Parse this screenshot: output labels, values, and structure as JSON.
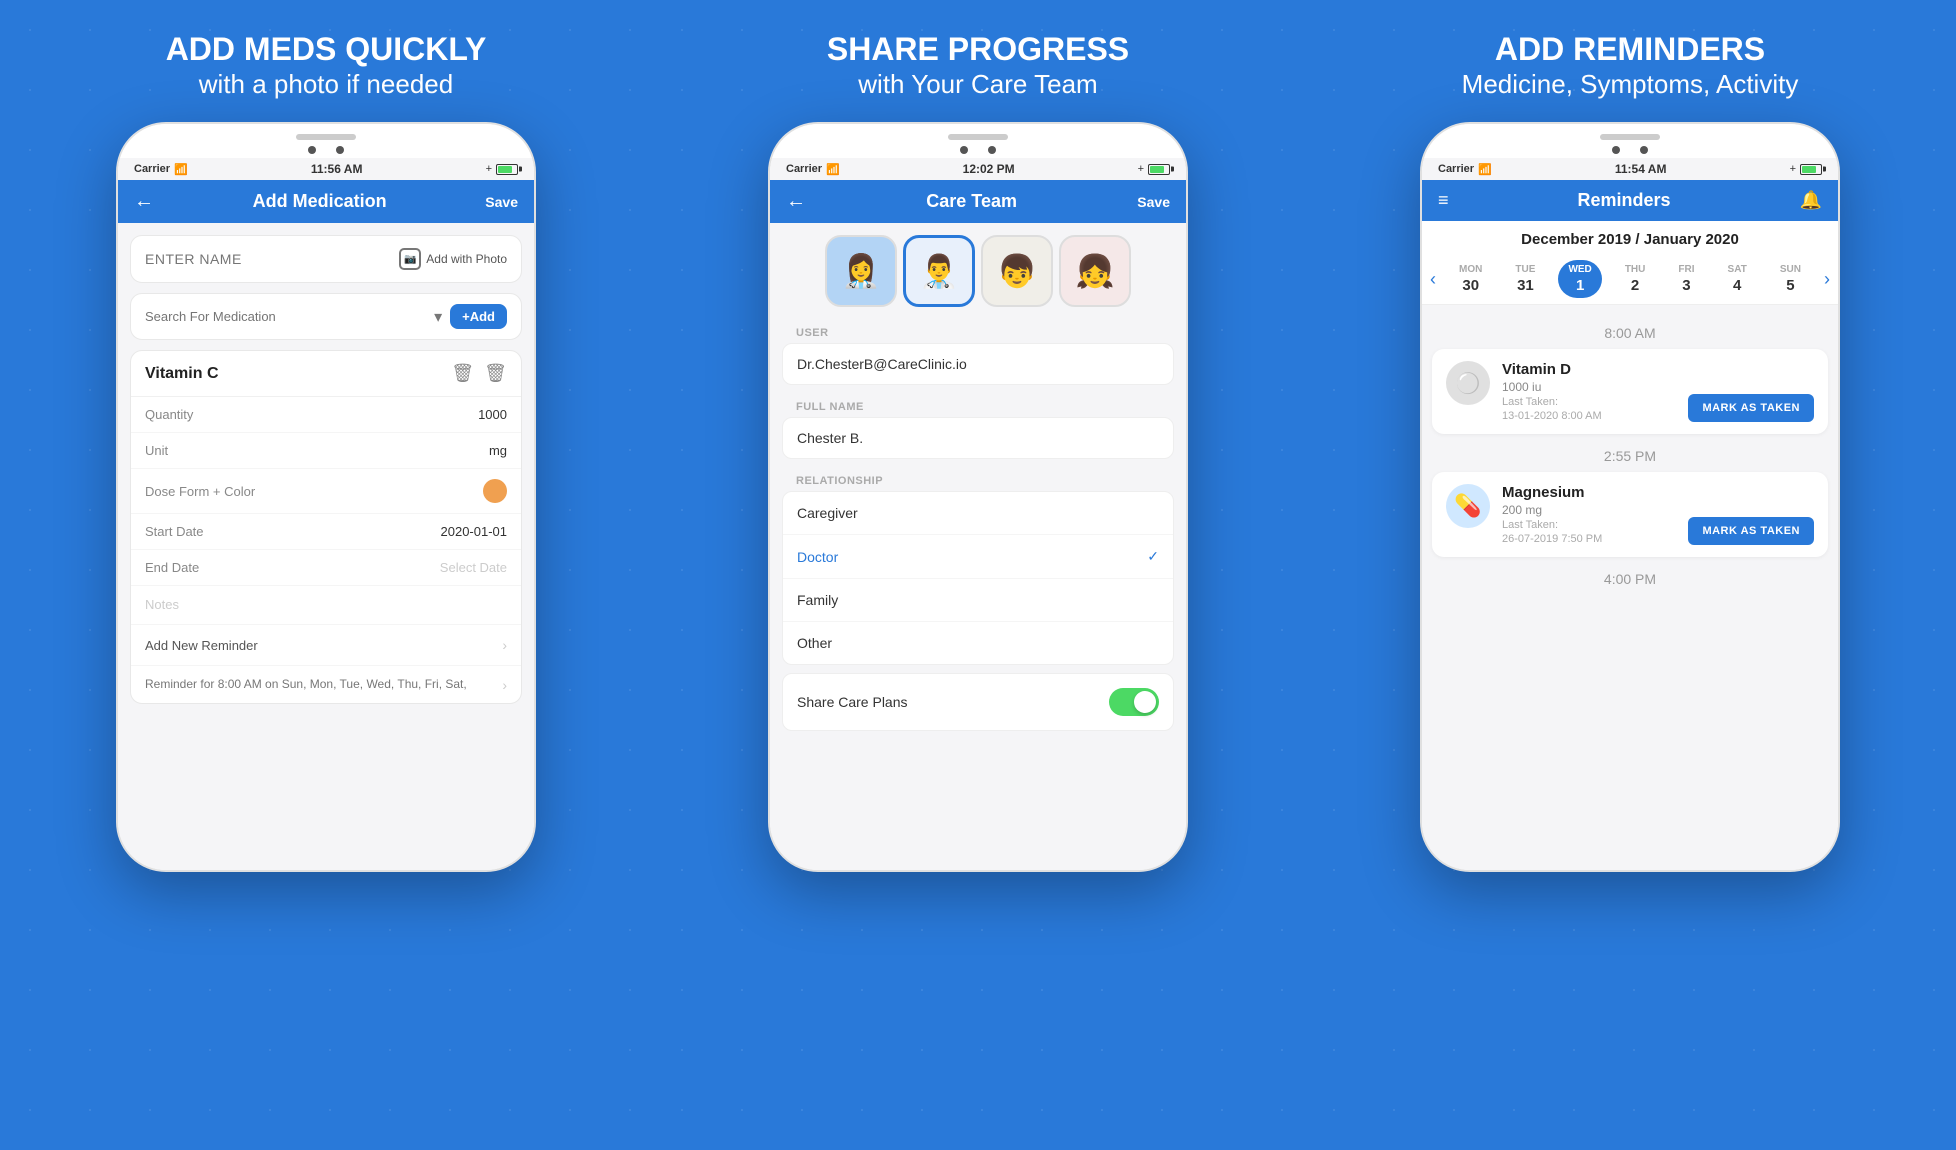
{
  "panel1": {
    "title_bold": "ADD MEDS QUICKLY",
    "title_sub": "with a photo if needed",
    "status_carrier": "Carrier",
    "status_wifi": "WiFi",
    "status_time": "11:56 AM",
    "header_title": "Add Medication",
    "header_save": "Save",
    "enter_name_placeholder": "ENTER NAME",
    "add_with_photo": "Add with Photo",
    "search_placeholder": "Search For Medication",
    "add_btn_label": "+Add",
    "med_name": "Vitamin C",
    "quantity_label": "Quantity",
    "quantity_value": "1000",
    "unit_label": "Unit",
    "unit_value": "mg",
    "dose_label": "Dose Form + Color",
    "start_date_label": "Start Date",
    "start_date_value": "2020-01-01",
    "end_date_label": "End Date",
    "end_date_placeholder": "Select Date",
    "notes_label": "Notes",
    "reminder_label": "Add New Reminder",
    "reminder_sub": "Reminder for  8:00 AM on  Sun, Mon, Tue, Wed, Thu, Fri, Sat,"
  },
  "panel2": {
    "title_bold": "SHARE PROGRESS",
    "title_sub": "with Your Care Team",
    "status_carrier": "Carrier",
    "status_wifi": "WiFi",
    "status_time": "12:02 PM",
    "header_title": "Care Team",
    "header_save": "Save",
    "user_label": "USER",
    "user_value": "Dr.ChesterB@CareClinic.io",
    "fullname_label": "FULL NAME",
    "fullname_value": "Chester B.",
    "relationship_label": "RELATIONSHIP",
    "rel_caregiver": "Caregiver",
    "rel_doctor": "Doctor",
    "rel_family": "Family",
    "rel_other": "Other",
    "share_label": "Share Care Plans",
    "avatars": [
      "👩‍⚕️",
      "👨‍⚕️",
      "👦",
      "👧"
    ]
  },
  "panel3": {
    "title_bold": "ADD REMINDERS",
    "title_sub": "Medicine, Symptoms, Activity",
    "status_carrier": "Carrier",
    "status_wifi": "WiFi",
    "status_time": "11:54 AM",
    "header_title": "Reminders",
    "month": "December 2019 / January 2020",
    "days": [
      {
        "name": "MON",
        "num": "30"
      },
      {
        "name": "TUE",
        "num": "31"
      },
      {
        "name": "WED",
        "num": "1",
        "active": true
      },
      {
        "name": "THU",
        "num": "2"
      },
      {
        "name": "FRI",
        "num": "3"
      },
      {
        "name": "SAT",
        "num": "4"
      },
      {
        "name": "SUN",
        "num": "5"
      }
    ],
    "time1": "8:00 AM",
    "med1_name": "Vitamin D",
    "med1_dose": "1000 iu",
    "med1_last_label": "Last Taken:",
    "med1_last_date": "13-01-2020 8:00 AM",
    "mark_taken1": "MARK AS TAKEN",
    "time2": "2:55 PM",
    "med2_name": "Magnesium",
    "med2_dose": "200 mg",
    "med2_last_label": "Last Taken:",
    "med2_last_date": "26-07-2019 7:50 PM",
    "mark_taken2": "MARK AS TAKEN",
    "time3": "4:00 PM"
  }
}
